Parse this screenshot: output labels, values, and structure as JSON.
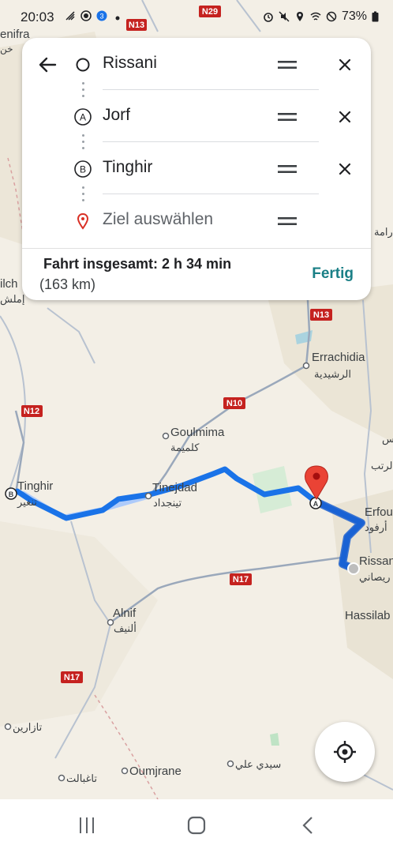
{
  "status_bar": {
    "time": "20:03",
    "battery": "73%",
    "road_badges": {
      "n29": "N29",
      "n13": "N13"
    }
  },
  "directions_card": {
    "stops": [
      {
        "label": "Rissani",
        "marker": "circle-origin-icon",
        "removable": true
      },
      {
        "label": "Jorf",
        "marker": "A",
        "removable": true
      },
      {
        "label": "Tinghir",
        "marker": "B",
        "removable": true
      },
      {
        "label": "Ziel auswählen",
        "marker": "pin-destination-icon",
        "removable": false,
        "placeholder": true
      }
    ],
    "total_label": "Fahrt insgesamt: 2 h 34 min",
    "distance_label": "(163 km)",
    "done_button": "Fertig"
  },
  "map": {
    "places": {
      "errachidia": "Errachidia",
      "errachidia_ar": "الرشيدية",
      "goulmima": "Goulmima",
      "goulmima_ar": "كلميمة",
      "tinejdad": "Tinejdad",
      "tinejdad_ar": "تينجداد",
      "tinghir": "Tinghir",
      "tinghir_ar": "تنغير",
      "erfoud": "Erfou",
      "erfoud_ar": "أرفود",
      "rissani": "Rissan",
      "rissani_ar": "ريصاني",
      "hassilabied": "Hassilab",
      "alnif": "Alnif",
      "alnif_ar": "ألنيف",
      "oumjrane": "Oumjrane",
      "sidi_ali_ar": "سيدي علي",
      "tazarine_ar": "تازارين",
      "taghbalte_ar": "تاغبالت",
      "khenifra": "enifra",
      "khenifra_ar": "خن",
      "imilchil": "ilch",
      "imilchil_ar": "إملش",
      "right_ar_1": "رامة",
      "right_ar_2": "س",
      "right_ar_3": "لرتب"
    },
    "roads": {
      "n13_top": "N13",
      "n12": "N12",
      "n10": "N10",
      "n17_a": "N17",
      "n17_b": "N17"
    },
    "route_markers": {
      "a": "A",
      "b": "B"
    },
    "colors": {
      "route": "#1a73e8",
      "route_inactive": "#aecbfa",
      "pin": "#ea4335",
      "road_badge": "#c5221f"
    }
  },
  "bottom_nav": [
    "recent-apps-icon",
    "home-icon",
    "back-icon"
  ]
}
